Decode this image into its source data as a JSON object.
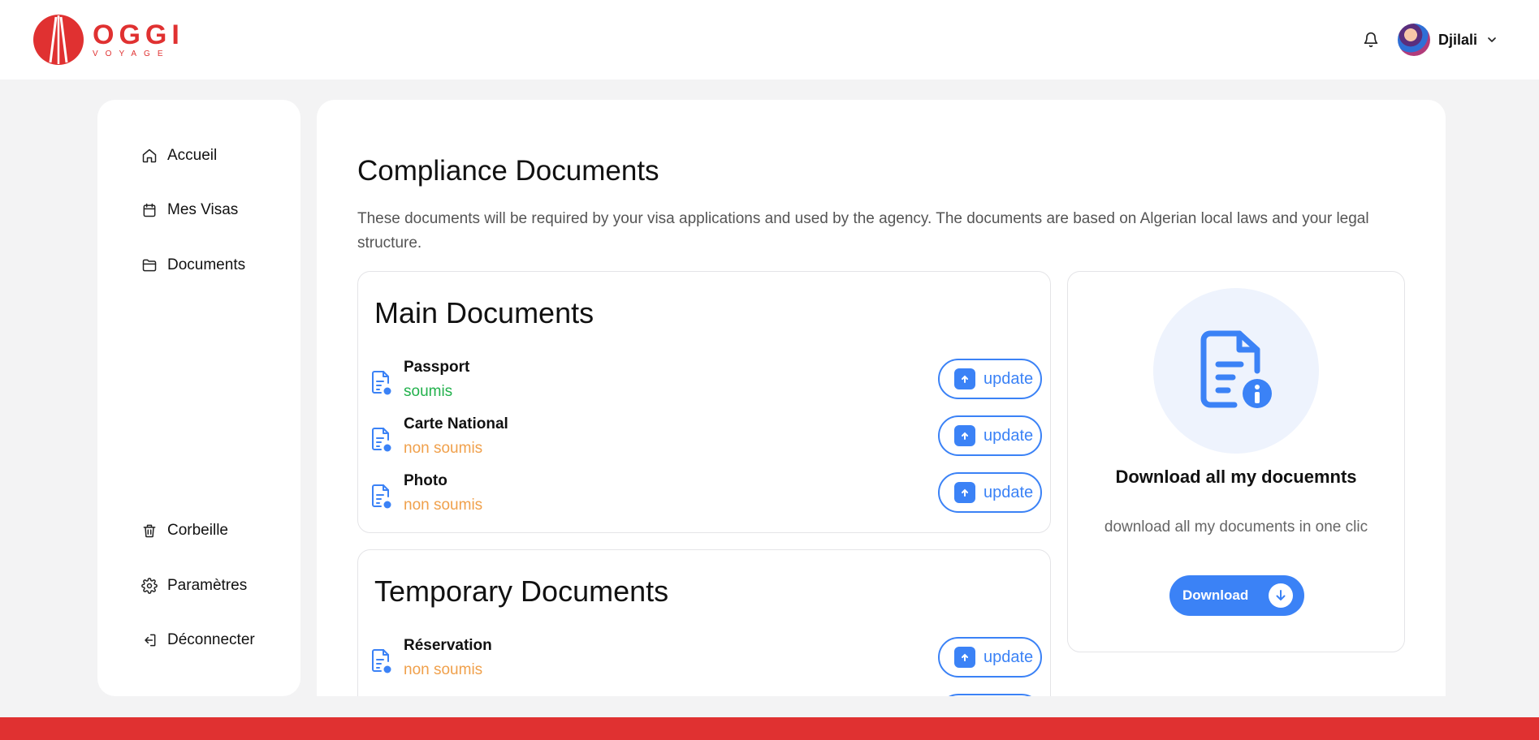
{
  "header": {
    "logo_word": "OGGI",
    "logo_sub": "VOYAGE",
    "user_name": "Djilali",
    "icons": {
      "bell": "bell-icon",
      "chevron": "chevron-down-icon"
    }
  },
  "sidebar": {
    "top_items": [
      {
        "label": "Accueil",
        "icon": "home-icon"
      },
      {
        "label": "Mes Visas",
        "icon": "calendar-icon"
      },
      {
        "label": "Documents",
        "icon": "folder-icon"
      }
    ],
    "bottom_items": [
      {
        "label": "Corbeille",
        "icon": "trash-icon"
      },
      {
        "label": "Paramètres",
        "icon": "gear-icon"
      },
      {
        "label": "Déconnecter",
        "icon": "logout-icon"
      }
    ]
  },
  "main": {
    "title": "Compliance Documents",
    "description": "These documents will be required by your visa applications and used by the agency. The documents are based on Algerian local laws and your legal structure.",
    "main_documents": {
      "title": "Main Documents",
      "items": [
        {
          "name": "Passport",
          "status": "soumis"
        },
        {
          "name": "Carte National",
          "status": "non soumis"
        },
        {
          "name": "Photo",
          "status": "non soumis"
        }
      ]
    },
    "temporary_documents": {
      "title": "Temporary Documents",
      "items": [
        {
          "name": "Réservation",
          "status": "non soumis"
        }
      ]
    },
    "update_label": "update",
    "download_card": {
      "title": "Download all my docuemnts",
      "description": "download all my documents in one clic",
      "button_label": "Download"
    }
  },
  "colors": {
    "brand_red": "#e03131",
    "accent_blue": "#3b82f6",
    "status_submitted": "#22b14c",
    "status_not_submitted": "#f0a04b"
  }
}
